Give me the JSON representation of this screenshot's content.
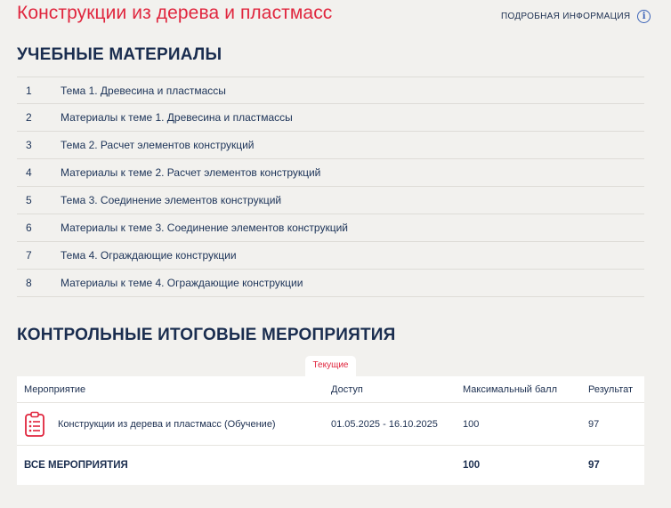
{
  "header": {
    "title": "Конструкции из дерева и пластмасс",
    "info_link": "ПОДРОБНАЯ ИНФОРМАЦИЯ",
    "info_icon": "info-circle-icon"
  },
  "materials": {
    "title": "УЧЕБНЫЕ МАТЕРИАЛЫ",
    "items": [
      {
        "num": "1",
        "label": "Тема 1. Древесина и пластмассы"
      },
      {
        "num": "2",
        "label": "Материалы к теме 1. Древесина и пластмассы"
      },
      {
        "num": "3",
        "label": "Тема 2. Расчет элементов конструкций"
      },
      {
        "num": "4",
        "label": "Материалы к теме 2. Расчет элементов конструкций"
      },
      {
        "num": "5",
        "label": "Тема 3. Соединение элементов конструкций"
      },
      {
        "num": "6",
        "label": "Материалы к теме 3. Соединение элементов конструкций"
      },
      {
        "num": "7",
        "label": "Тема 4. Ограждающие конструкции"
      },
      {
        "num": "8",
        "label": "Материалы к теме 4. Ограждающие конструкции"
      }
    ]
  },
  "events": {
    "title": "КОНТРОЛЬНЫЕ ИТОГОВЫЕ МЕРОПРИЯТИЯ",
    "tab": "Текущие",
    "columns": [
      "Мероприятие",
      "Доступ",
      "Максимальный балл",
      "Результат"
    ],
    "rows": [
      {
        "name": "Конструкции из дерева и пластмасс (Обучение)",
        "access": "01.05.2025 - 16.10.2025",
        "max": "100",
        "result": "97",
        "icon": "clipboard-icon"
      }
    ],
    "total": {
      "label": "ВСЕ МЕРОПРИЯТИЯ",
      "max": "100",
      "result": "97"
    }
  },
  "colors": {
    "accent": "#e0263e",
    "text": "#1c2f50",
    "link_icon": "#3b63b8",
    "background": "#f2f1ee"
  }
}
